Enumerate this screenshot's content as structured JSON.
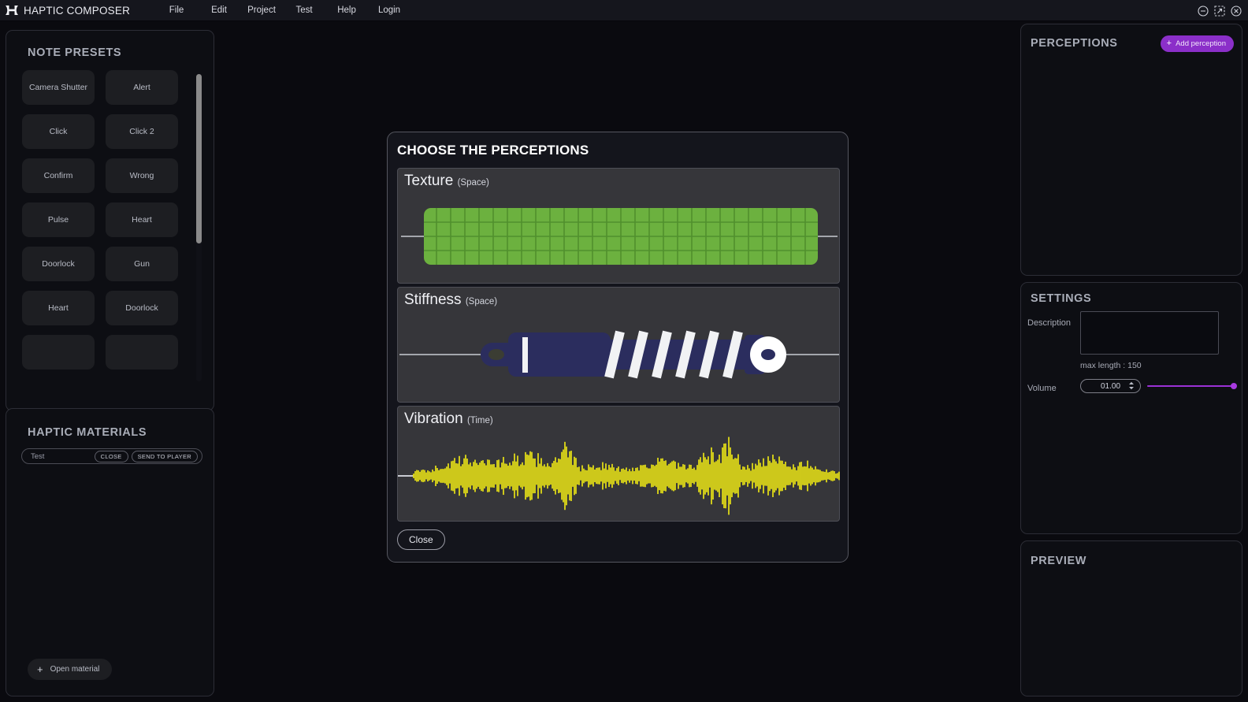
{
  "titlebar": {
    "app_title": "HAPTIC COMPOSER",
    "logo_icon": "hourglass-logo-icon",
    "menu": [
      {
        "label": "File"
      },
      {
        "label": "Edit"
      },
      {
        "label": "Project"
      },
      {
        "label": "Test"
      },
      {
        "label": "Help"
      },
      {
        "label": "Login"
      }
    ],
    "window_controls": [
      {
        "icon": "minimize-icon"
      },
      {
        "icon": "maximize-icon"
      },
      {
        "icon": "close-icon"
      }
    ]
  },
  "note_presets": {
    "title": "NOTE PRESETS",
    "rows": [
      [
        {
          "label": "Camera Shutter"
        },
        {
          "label": "Alert"
        }
      ],
      [
        {
          "label": "Click"
        },
        {
          "label": "Click 2"
        }
      ],
      [
        {
          "label": "Confirm"
        },
        {
          "label": "Wrong"
        }
      ],
      [
        {
          "label": "Pulse"
        },
        {
          "label": "Heart"
        }
      ],
      [
        {
          "label": "Doorlock"
        },
        {
          "label": "Gun"
        }
      ],
      [
        {
          "label": "Heart"
        },
        {
          "label": "Doorlock"
        }
      ],
      [
        {
          "label": ""
        },
        {
          "label": ""
        }
      ]
    ]
  },
  "haptic_materials": {
    "title": "HAPTIC MATERIALS",
    "material_name": "Test",
    "close_label": "CLOSE",
    "send_label": "SEND TO PLAYER",
    "open_material_label": "Open material",
    "plus_glyph": "+"
  },
  "perceptions_panel": {
    "title": "PERCEPTIONS",
    "add_label": "Add perception",
    "plus_glyph": "+",
    "accent_color": "#8b2fc9"
  },
  "settings_panel": {
    "title": "SETTINGS",
    "description_label": "Description",
    "description_value": "",
    "description_placeholder": "",
    "max_length_text": "max length : 150",
    "volume_label": "Volume",
    "volume_value": "01.00",
    "volume_slider_percent": 100,
    "slider_color": "#9a31d6"
  },
  "preview_panel": {
    "title": "PREVIEW"
  },
  "modal": {
    "title": "CHOOSE THE PERCEPTIONS",
    "close_label": "Close",
    "cards": [
      {
        "name": "Texture",
        "domain": "(Space)",
        "art": "texture-green-grid",
        "color": "#6cb13f"
      },
      {
        "name": "Stiffness",
        "domain": "(Space)",
        "art": "spring-damper",
        "color": "#2b2d5e"
      },
      {
        "name": "Vibration",
        "domain": "(Time)",
        "art": "waveform-yellow",
        "color": "#e8e316"
      }
    ]
  }
}
